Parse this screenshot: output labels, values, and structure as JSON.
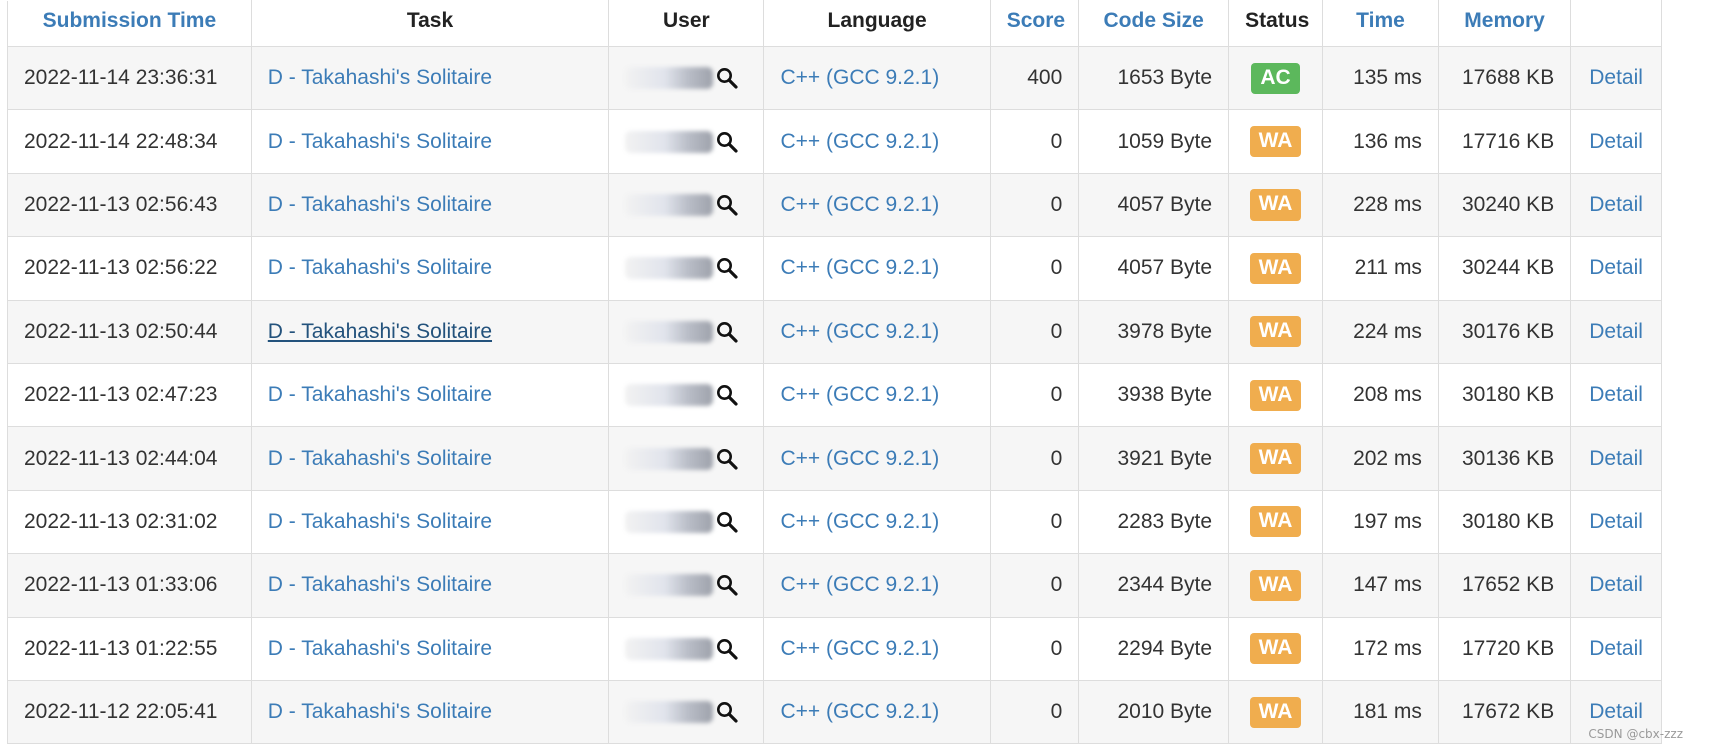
{
  "columns": {
    "submission_time": "Submission Time",
    "task": "Task",
    "user": "User",
    "language": "Language",
    "score": "Score",
    "code_size": "Code Size",
    "status": "Status",
    "time": "Time",
    "memory": "Memory"
  },
  "rows": [
    {
      "submission_time": "2022-11-14 23:36:31",
      "task": "D - Takahashi's Solitaire",
      "language": "C++ (GCC 9.2.1)",
      "score": "400",
      "code_size": "1653 Byte",
      "status": "AC",
      "time": "135 ms",
      "memory": "17688 KB",
      "detail": "Detail"
    },
    {
      "submission_time": "2022-11-14 22:48:34",
      "task": "D - Takahashi's Solitaire",
      "language": "C++ (GCC 9.2.1)",
      "score": "0",
      "code_size": "1059 Byte",
      "status": "WA",
      "time": "136 ms",
      "memory": "17716 KB",
      "detail": "Detail"
    },
    {
      "submission_time": "2022-11-13 02:56:43",
      "task": "D - Takahashi's Solitaire",
      "language": "C++ (GCC 9.2.1)",
      "score": "0",
      "code_size": "4057 Byte",
      "status": "WA",
      "time": "228 ms",
      "memory": "30240 KB",
      "detail": "Detail"
    },
    {
      "submission_time": "2022-11-13 02:56:22",
      "task": "D - Takahashi's Solitaire",
      "language": "C++ (GCC 9.2.1)",
      "score": "0",
      "code_size": "4057 Byte",
      "status": "WA",
      "time": "211 ms",
      "memory": "30244 KB",
      "detail": "Detail"
    },
    {
      "submission_time": "2022-11-13 02:50:44",
      "task": "D - Takahashi's Solitaire",
      "language": "C++ (GCC 9.2.1)",
      "score": "0",
      "code_size": "3978 Byte",
      "status": "WA",
      "time": "224 ms",
      "memory": "30176 KB",
      "detail": "Detail"
    },
    {
      "submission_time": "2022-11-13 02:47:23",
      "task": "D - Takahashi's Solitaire",
      "language": "C++ (GCC 9.2.1)",
      "score": "0",
      "code_size": "3938 Byte",
      "status": "WA",
      "time": "208 ms",
      "memory": "30180 KB",
      "detail": "Detail"
    },
    {
      "submission_time": "2022-11-13 02:44:04",
      "task": "D - Takahashi's Solitaire",
      "language": "C++ (GCC 9.2.1)",
      "score": "0",
      "code_size": "3921 Byte",
      "status": "WA",
      "time": "202 ms",
      "memory": "30136 KB",
      "detail": "Detail"
    },
    {
      "submission_time": "2022-11-13 02:31:02",
      "task": "D - Takahashi's Solitaire",
      "language": "C++ (GCC 9.2.1)",
      "score": "0",
      "code_size": "2283 Byte",
      "status": "WA",
      "time": "197 ms",
      "memory": "30180 KB",
      "detail": "Detail"
    },
    {
      "submission_time": "2022-11-13 01:33:06",
      "task": "D - Takahashi's Solitaire",
      "language": "C++ (GCC 9.2.1)",
      "score": "0",
      "code_size": "2344 Byte",
      "status": "WA",
      "time": "147 ms",
      "memory": "17652 KB",
      "detail": "Detail"
    },
    {
      "submission_time": "2022-11-13 01:22:55",
      "task": "D - Takahashi's Solitaire",
      "language": "C++ (GCC 9.2.1)",
      "score": "0",
      "code_size": "2294 Byte",
      "status": "WA",
      "time": "172 ms",
      "memory": "17720 KB",
      "detail": "Detail"
    },
    {
      "submission_time": "2022-11-12 22:05:41",
      "task": "D - Takahashi's Solitaire",
      "language": "C++ (GCC 9.2.1)",
      "score": "0",
      "code_size": "2010 Byte",
      "status": "WA",
      "time": "181 ms",
      "memory": "17672 KB",
      "detail": "Detail"
    }
  ],
  "watermark": "CSDN @cbx-zzz",
  "colors": {
    "link": "#3c7cb7",
    "ac": "#5cb85c",
    "wa": "#f0ad4e",
    "row_stripe": "#f6f6f6",
    "border": "#dddddd"
  },
  "icons": {
    "user_search": "magnifier-icon"
  }
}
